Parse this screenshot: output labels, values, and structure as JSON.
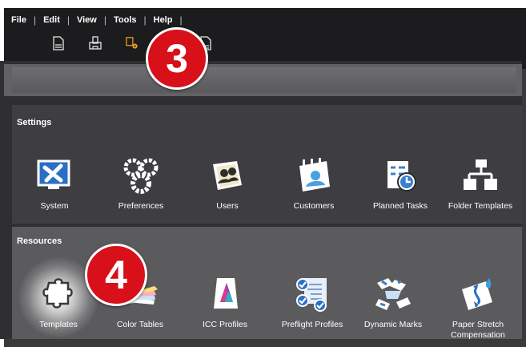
{
  "menu": {
    "items": [
      "File",
      "Edit",
      "View",
      "Tools",
      "Help"
    ]
  },
  "toolbar": {
    "icons": [
      "document-abc-icon",
      "print-icon",
      "settings-gear-icon",
      "document-icon",
      "document-ddd-icon"
    ]
  },
  "settings": {
    "title": "Settings",
    "items": [
      {
        "label": "System",
        "icon": "system-tools-icon"
      },
      {
        "label": "Preferences",
        "icon": "gears-icon"
      },
      {
        "label": "Users",
        "icon": "users-icon"
      },
      {
        "label": "Customers",
        "icon": "customers-icon"
      },
      {
        "label": "Planned Tasks",
        "icon": "planned-tasks-icon"
      },
      {
        "label": "Folder Templates",
        "icon": "folder-templates-icon"
      }
    ]
  },
  "resources": {
    "title": "Resources",
    "items": [
      {
        "label": "Templates",
        "icon": "puzzle-piece-icon"
      },
      {
        "label": "Color Tables",
        "icon": "color-swatches-icon"
      },
      {
        "label": "ICC Profiles",
        "icon": "icc-profile-icon"
      },
      {
        "label": "Preflight Profiles",
        "icon": "preflight-check-icon"
      },
      {
        "label": "Dynamic Marks",
        "icon": "dynamic-marks-icon"
      },
      {
        "label": "Paper Stretch Compensation",
        "icon": "paper-stretch-icon"
      }
    ]
  },
  "callouts": [
    "3",
    "4"
  ],
  "colors": {
    "topbar": "#1c1c1e",
    "settings_bg": "#3e3d42",
    "resources_bg": "#5b5b5e",
    "badge": "#d8101a",
    "accent_orange": "#f0a020",
    "icon_blue": "#3a7fd0"
  }
}
